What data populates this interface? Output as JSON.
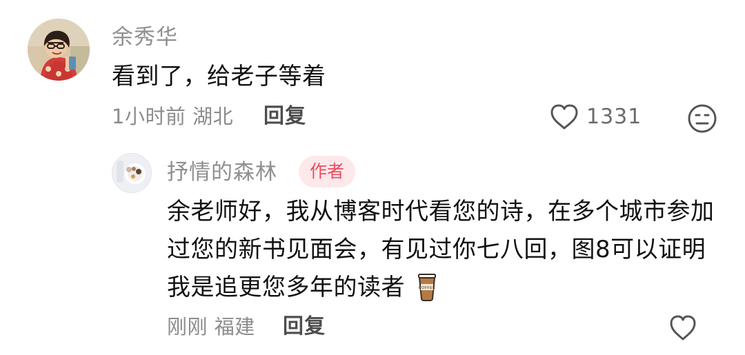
{
  "comment_1": {
    "username": "余秀华",
    "content": "看到了，给老子等着",
    "meta": "1小时前 湖北",
    "reply_label": "回复",
    "likes": "1331"
  },
  "comment_2": {
    "username": "抒情的森林",
    "author_badge": "作者",
    "content": "余老师好，我从博客时代看您的诗，在多个城市参加过您的新书见面会，有见过你七八回，图8可以证明我是追更您多年的读者",
    "emoji_text": "COFFEE",
    "meta": "刚刚 福建",
    "reply_label": "回复"
  },
  "colors": {
    "username": "#8f8f8f",
    "content": "#111111",
    "meta": "#8c8c8c",
    "badge_bg": "#fde8ea",
    "badge_text": "#ec4a61"
  }
}
